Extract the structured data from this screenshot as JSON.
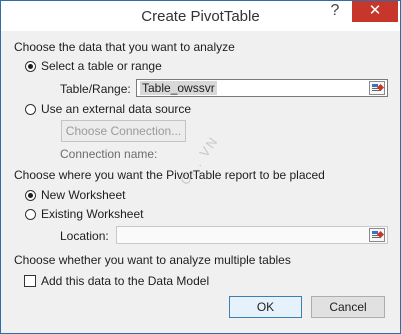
{
  "window": {
    "title": "Create PivotTable",
    "help_label": "?",
    "close_label": "✕"
  },
  "section_choose_data": {
    "heading": "Choose the data that you want to analyze",
    "select_table_label": "Select a table or range",
    "select_table_checked": true,
    "table_range_label": "Table/Range:",
    "table_range_value": "Table_owssvr",
    "external_label": "Use an external data source",
    "external_checked": false,
    "choose_connection_label": "Choose Connection...",
    "connection_name_label": "Connection name:"
  },
  "section_placement": {
    "heading": "Choose where you want the PivotTable report to be placed",
    "new_worksheet_label": "New Worksheet",
    "new_worksheet_checked": true,
    "existing_worksheet_label": "Existing Worksheet",
    "existing_worksheet_checked": false,
    "location_label": "Location:",
    "location_value": ""
  },
  "section_multiple_tables": {
    "heading": "Choose whether you want to analyze multiple tables",
    "data_model_label": "Add this data to the Data Model",
    "data_model_checked": false
  },
  "buttons": {
    "ok_label": "OK",
    "cancel_label": "Cancel"
  },
  "watermark": "C... VN",
  "icons": {
    "range_picker": "range-selector-icon"
  }
}
